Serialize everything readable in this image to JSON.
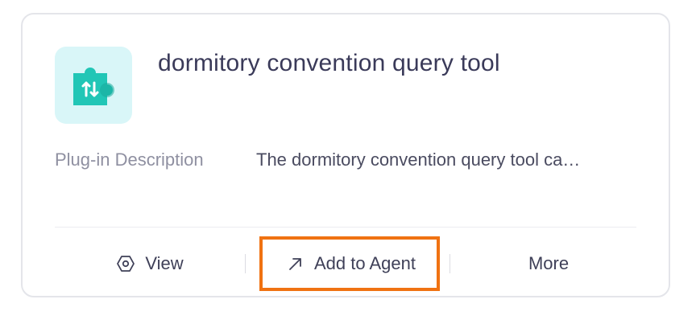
{
  "plugin": {
    "name": "dormitory convention query tool",
    "icon": "puzzle-piece-sort-icon",
    "icon_color": "#21c6b6",
    "icon_bg": "#d9f6f8"
  },
  "description": {
    "label": "Plug-in Description",
    "text": "The dormitory convention query tool ca…"
  },
  "actions": {
    "view_label": "View",
    "view_icon": "hexagon-eye-icon",
    "add_label": "Add to Agent",
    "add_icon": "arrow-up-right-icon",
    "more_label": "More"
  },
  "highlight_color": "#f07212"
}
